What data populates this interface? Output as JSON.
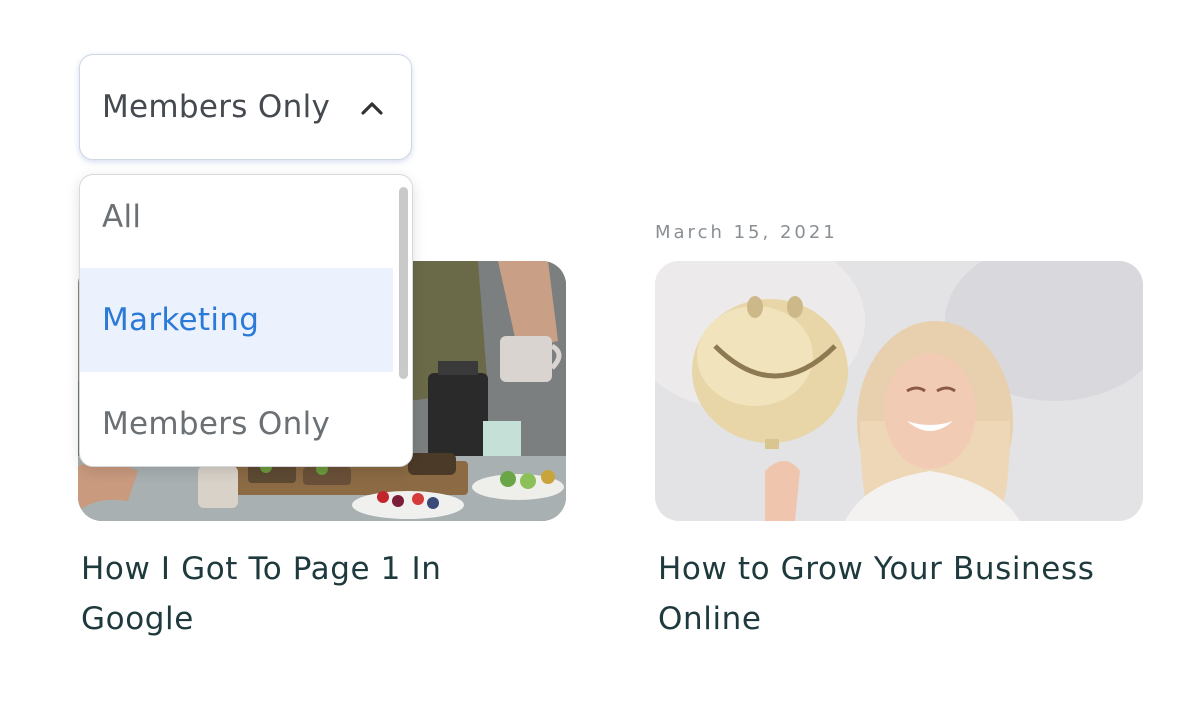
{
  "filter": {
    "selected": "Members Only",
    "expanded": true,
    "options": [
      "All",
      "Marketing",
      "Members Only"
    ],
    "highlighted": "Marketing",
    "icon": "chevron-up-icon"
  },
  "posts": [
    {
      "date": "",
      "title": "How I Got To Page 1 In Google",
      "image": "breakfast-table-photo"
    },
    {
      "date": "March 15, 2021",
      "title": "How to Grow Your Business Online",
      "image": "smiley-balloon-woman-photo"
    }
  ],
  "colors": {
    "title_text": "#1f3a3d",
    "date_text": "#8a8f93",
    "menu_highlight_bg": "#ebf2fe",
    "menu_highlight_text": "#2b7ad8"
  }
}
